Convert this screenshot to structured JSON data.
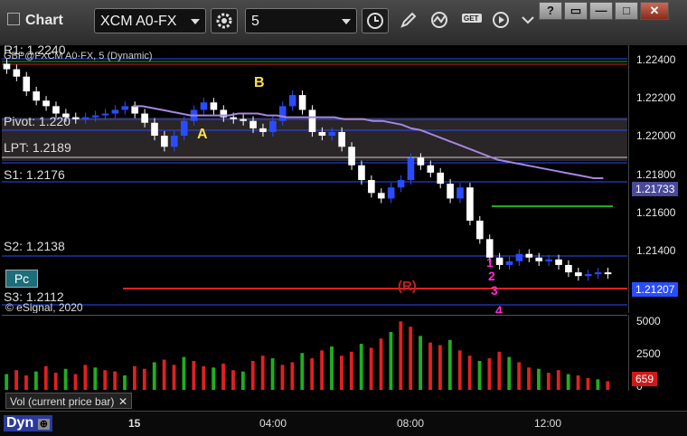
{
  "toolbar": {
    "title": "Chart",
    "symbol": "XCM A0-FX",
    "interval": "5",
    "icons": [
      "gear-icon",
      "clock-icon",
      "pencil-icon",
      "chart-wave-icon",
      "get-icon",
      "play-icon",
      "more-icon"
    ],
    "window_buttons": [
      "?",
      "▭",
      "—",
      "□",
      "✕"
    ]
  },
  "chart": {
    "header": "GBP@FXCM A0-FX, 5 (Dynamic)",
    "levels": {
      "r1": "R1: 1.2240",
      "pivot": "Pivot: 1.220",
      "lpt": "LPT: 1.2189",
      "s1": "S1: 1.2176",
      "s2": "S2: 1.2138",
      "s3": "S3: 1.2112"
    },
    "annotations": {
      "a": "A",
      "b": "B",
      "r": "(R)",
      "pc": "Pc"
    },
    "seq_labels": [
      "1",
      "2",
      "3",
      "4"
    ],
    "copyright": "© eSignal, 2020",
    "y_ticks": [
      "1.22400",
      "1.22200",
      "1.22000",
      "1.21800",
      "1.21600",
      "1.21400",
      "1.21200"
    ],
    "price_badges": {
      "last": "1.21207",
      "avg": "1.21733"
    }
  },
  "volume": {
    "legend": "Vol (current price bar)",
    "y_ticks": [
      "5000",
      "2500",
      "0"
    ],
    "last": "659"
  },
  "xaxis": {
    "ticks": [
      "15",
      "04:00",
      "08:00",
      "12:00"
    ],
    "dyn": "Dyn"
  },
  "colors": {
    "up": "#2a4cff",
    "down": "#ffffff",
    "ma": "#a586e0",
    "red": "#e02020",
    "green": "#1fae1f"
  },
  "chart_data": {
    "type": "candlestick",
    "y_range": [
      1.21,
      1.2245
    ],
    "x_ticks": [
      "15",
      "04:00",
      "08:00",
      "12:00"
    ],
    "levels": {
      "R1": 1.224,
      "Pivot": 1.2203,
      "LPT": 1.2189,
      "S1": 1.2176,
      "S2": 1.2138,
      "S3": 1.2112
    },
    "close_series": [
      1.2232,
      1.2228,
      1.222,
      1.2215,
      1.2212,
      1.2208,
      1.2206,
      1.2205,
      1.2206,
      1.2207,
      1.2208,
      1.221,
      1.2212,
      1.2208,
      1.2203,
      1.2196,
      1.219,
      1.2196,
      1.2204,
      1.221,
      1.2214,
      1.221,
      1.2206,
      1.2205,
      1.2204,
      1.22,
      1.2198,
      1.2204,
      1.2212,
      1.2218,
      1.221,
      1.2198,
      1.2196,
      1.2198,
      1.219,
      1.218,
      1.2172,
      1.2165,
      1.2162,
      1.2168,
      1.2172,
      1.2184,
      1.218,
      1.2176,
      1.217,
      1.2162,
      1.2168,
      1.215,
      1.214,
      1.213,
      1.2126,
      1.2128,
      1.2132,
      1.213,
      1.2128,
      1.2129,
      1.2126,
      1.2122,
      1.212,
      1.2121,
      1.2122,
      1.2121
    ],
    "ma_series": [
      1.2212,
      1.2212,
      1.2211,
      1.221,
      1.2209,
      1.2208,
      1.2207,
      1.2207,
      1.2207,
      1.2207,
      1.2207,
      1.2208,
      1.2208,
      1.2208,
      1.2207,
      1.2207,
      1.2206,
      1.2206,
      1.2206,
      1.2206,
      1.2206,
      1.2206,
      1.2205,
      1.2205,
      1.2205,
      1.2204,
      1.2204,
      1.2203,
      1.2202,
      1.22,
      1.2199,
      1.2197,
      1.2195,
      1.2193,
      1.2191,
      1.2189,
      1.2187,
      1.2185,
      1.2183,
      1.2182,
      1.2181,
      1.218,
      1.2179,
      1.2178,
      1.2177,
      1.2176,
      1.2175,
      1.2174,
      1.2173,
      1.2173
    ],
    "volume": [
      1200,
      1500,
      1100,
      1400,
      1800,
      1300,
      1600,
      1200,
      1900,
      1700,
      1500,
      1400,
      1100,
      1800,
      1600,
      2100,
      2300,
      1900,
      2500,
      2200,
      1800,
      1700,
      2000,
      1500,
      1400,
      2200,
      2600,
      2400,
      1900,
      2100,
      2800,
      2400,
      3000,
      3300,
      2600,
      2900,
      3500,
      3200,
      3900,
      4400,
      5200,
      4800,
      4100,
      3600,
      3400,
      3800,
      3000,
      2600,
      2200,
      2400,
      2900,
      2500,
      2100,
      1700,
      1600,
      1300,
      1500,
      1200,
      1100,
      900,
      800,
      659
    ]
  }
}
